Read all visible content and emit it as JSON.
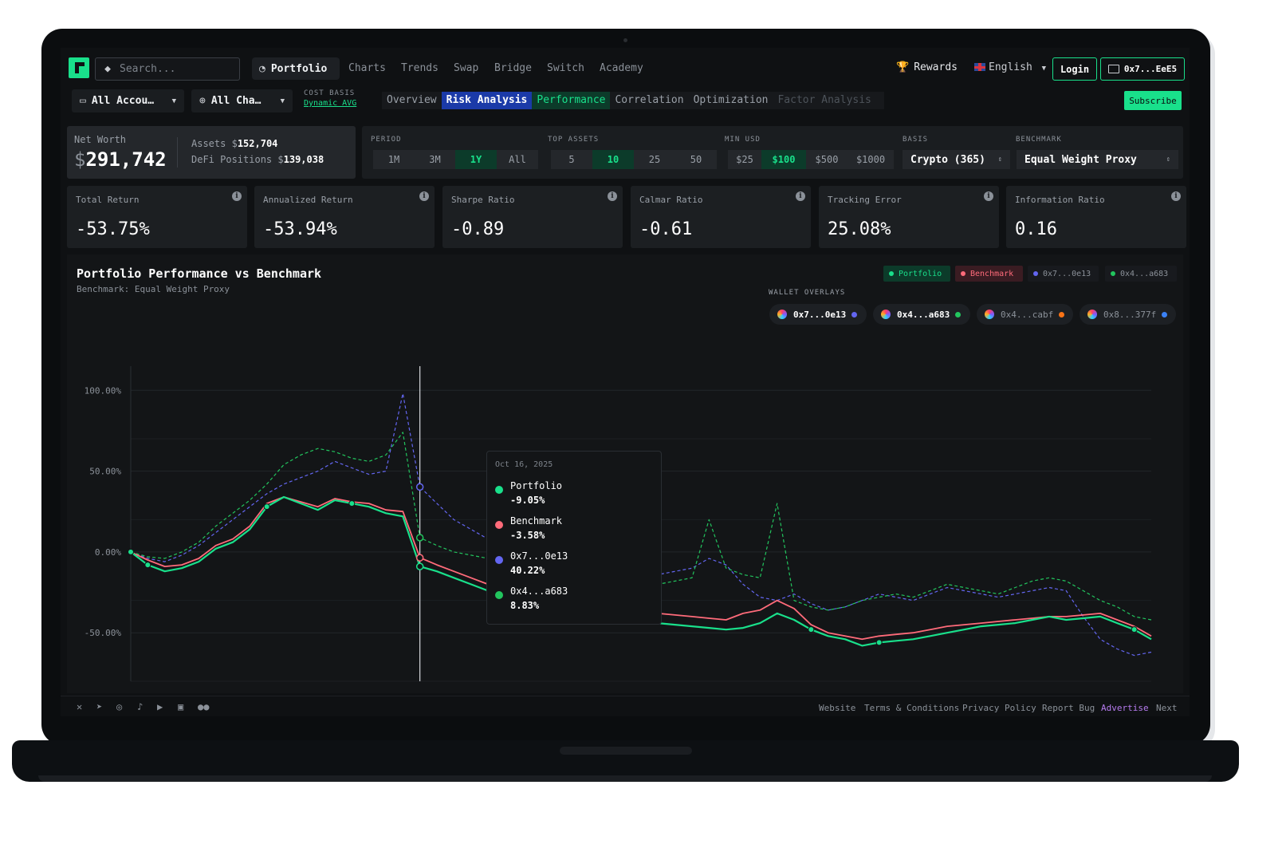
{
  "nav": {
    "search_placeholder": "Search...",
    "portfolio": "Portfolio",
    "links": [
      "Charts",
      "Trends",
      "Swap",
      "Bridge",
      "Switch",
      "Academy"
    ],
    "rewards": "Rewards",
    "language": "English",
    "login": "Login",
    "wallet": "0x7...EeE5"
  },
  "subnav": {
    "accounts": "All Accou…",
    "chains": "All Cha…",
    "cost_basis_label": "COST BASIS",
    "cost_basis_value": "Dynamic AVG",
    "tabs": [
      "Overview",
      "Risk Analysis",
      "Performance",
      "Correlation",
      "Optimization",
      "Factor Analysis"
    ],
    "subscribe": "Subscribe"
  },
  "summary": {
    "net_worth_label": "Net Worth",
    "net_worth_currency": "$",
    "net_worth": "291,742",
    "assets_label": "Assets",
    "assets_value": "152,704",
    "defi_label": "DeFi Positions",
    "defi_value": "139,038",
    "currency": "$"
  },
  "filters": {
    "period_label": "PERIOD",
    "period_options": [
      "1M",
      "3M",
      "1Y",
      "All"
    ],
    "period_selected": "1Y",
    "top_assets_label": "TOP ASSETS",
    "top_assets_options": [
      "5",
      "10",
      "25",
      "50"
    ],
    "top_assets_selected": "10",
    "min_usd_label": "MIN USD",
    "min_usd_options": [
      "$25",
      "$100",
      "$500",
      "$1000"
    ],
    "min_usd_selected": "$100",
    "basis_label": "BASIS",
    "basis_value": "Crypto (365)",
    "benchmark_label": "BENCHMARK",
    "benchmark_value": "Equal Weight Proxy"
  },
  "metrics": [
    {
      "label": "Total Return",
      "value": "-53.75%"
    },
    {
      "label": "Annualized Return",
      "value": "-53.94%"
    },
    {
      "label": "Sharpe Ratio",
      "value": "-0.89"
    },
    {
      "label": "Calmar Ratio",
      "value": "-0.61"
    },
    {
      "label": "Tracking Error",
      "value": "25.08%"
    },
    {
      "label": "Information Ratio",
      "value": "0.16"
    }
  ],
  "chart": {
    "title": "Portfolio Performance vs Benchmark",
    "subtitle": "Benchmark: Equal Weight Proxy",
    "legend": [
      {
        "label": "Portfolio",
        "color": "#19e08b"
      },
      {
        "label": "Benchmark",
        "color": "#ff6b7a"
      },
      {
        "label": "0x7...0e13",
        "color": "#6366f1"
      },
      {
        "label": "0x4...a683",
        "color": "#22c55e"
      }
    ],
    "wallet_overlays_label": "WALLET OVERLAYS",
    "wallet_overlays": [
      {
        "label": "0x7...0e13",
        "color": "#6366f1",
        "active": true
      },
      {
        "label": "0x4...a683",
        "color": "#22c55e",
        "active": true
      },
      {
        "label": "0x4...cabf",
        "color": "#f97316",
        "active": false
      },
      {
        "label": "0x8...377f",
        "color": "#3b82f6",
        "active": false
      }
    ],
    "tooltip": {
      "date": "Oct 16, 2025",
      "rows": [
        {
          "name": "Portfolio",
          "value": "-9.05%",
          "color": "#19e08b"
        },
        {
          "name": "Benchmark",
          "value": "-3.58%",
          "color": "#ff6b7a"
        },
        {
          "name": "0x7...0e13",
          "value": "40.22%",
          "color": "#6366f1"
        },
        {
          "name": "0x4...a683",
          "value": "8.83%",
          "color": "#22c55e"
        }
      ]
    }
  },
  "chart_data": {
    "type": "line",
    "title": "Portfolio Performance vs Benchmark",
    "subtitle": "Benchmark: Equal Weight Proxy",
    "y_tick_labels": [
      "100.00%",
      "50.00%",
      "0.00%",
      "-50.00%"
    ],
    "ylim": [
      -80,
      110
    ],
    "grid": true,
    "legend_position": "top-right",
    "x": [
      0,
      1,
      2,
      3,
      4,
      5,
      6,
      7,
      8,
      9,
      10,
      11,
      12,
      13,
      14,
      15,
      16,
      17,
      18,
      19,
      20,
      21,
      22,
      23,
      24,
      25,
      26,
      27,
      28,
      29,
      30,
      31,
      32,
      33,
      34,
      35,
      36,
      37,
      38,
      39,
      40,
      41,
      42,
      43,
      44,
      45,
      46,
      47,
      48,
      49,
      50,
      51,
      52,
      53,
      54,
      55,
      56,
      57,
      58,
      59,
      60
    ],
    "series": [
      {
        "name": "Portfolio",
        "values": [
          0,
          -8,
          -12,
          -10,
          -6,
          2,
          6,
          14,
          28,
          34,
          30,
          26,
          32,
          30,
          28,
          24,
          22,
          -9,
          -12,
          -16,
          -20,
          -24,
          -28,
          -30,
          -32,
          -34,
          -36,
          -37,
          -38,
          -40,
          -42,
          -44,
          -45,
          -46,
          -47,
          -48,
          -47,
          -44,
          -38,
          -42,
          -48,
          -52,
          -54,
          -58,
          -56,
          -55,
          -54,
          -52,
          -50,
          -48,
          -46,
          -45,
          -44,
          -42,
          -40,
          -42,
          -41,
          -40,
          -44,
          -48,
          -54
        ]
      },
      {
        "name": "Benchmark",
        "values": [
          0,
          -5,
          -9,
          -8,
          -4,
          4,
          8,
          16,
          30,
          34,
          31,
          28,
          33,
          31,
          30,
          26,
          25,
          -3.58,
          -8,
          -12,
          -16,
          -20,
          -24,
          -27,
          -29,
          -30,
          -32,
          -33,
          -34,
          -34,
          -36,
          -38,
          -39,
          -40,
          -41,
          -42,
          -38,
          -36,
          -30,
          -35,
          -45,
          -50,
          -52,
          -54,
          -52,
          -51,
          -50,
          -48,
          -46,
          -45,
          -44,
          -43,
          -42,
          -41,
          -40,
          -40,
          -39,
          -38,
          -42,
          -46,
          -52
        ]
      },
      {
        "name": "0x7...0e13",
        "values": [
          0,
          -4,
          -6,
          -2,
          4,
          12,
          20,
          28,
          36,
          42,
          46,
          50,
          56,
          52,
          48,
          50,
          98,
          40.22,
          30,
          20,
          14,
          8,
          4,
          2,
          0,
          -2,
          -4,
          -6,
          -8,
          -10,
          -12,
          -14,
          -12,
          -10,
          -4,
          -8,
          -20,
          -28,
          -30,
          -26,
          -32,
          -36,
          -34,
          -30,
          -26,
          -28,
          -30,
          -26,
          -22,
          -24,
          -26,
          -28,
          -26,
          -24,
          -22,
          -24,
          -40,
          -54,
          -60,
          -64,
          -62
        ]
      },
      {
        "name": "0x4...a683",
        "values": [
          0,
          -3,
          -4,
          0,
          6,
          16,
          24,
          32,
          42,
          54,
          60,
          64,
          62,
          58,
          56,
          60,
          74,
          8.83,
          4,
          0,
          -2,
          -4,
          -6,
          -8,
          -10,
          -12,
          -14,
          -16,
          -18,
          -20,
          -22,
          -20,
          -18,
          -16,
          20,
          -10,
          -14,
          -16,
          30,
          -30,
          -34,
          -36,
          -34,
          -30,
          -28,
          -26,
          -28,
          -24,
          -20,
          -22,
          -24,
          -26,
          -22,
          -18,
          -16,
          -18,
          -24,
          -30,
          -34,
          -40,
          -42
        ]
      }
    ]
  },
  "footer": {
    "links": [
      "Website",
      "Terms & Conditions",
      "Privacy Policy",
      "Report Bug",
      "Advertise",
      "Next"
    ]
  }
}
